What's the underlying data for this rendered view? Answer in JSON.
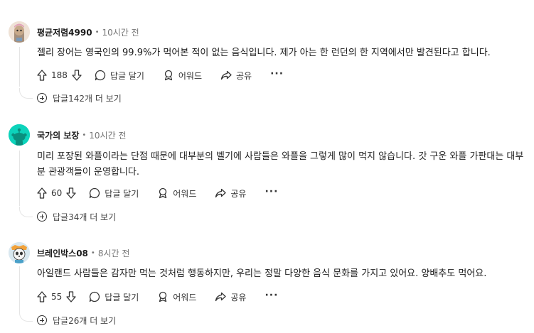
{
  "comments": [
    {
      "author": "평균저렴4990",
      "time": "10시간 전",
      "body": "젤리 장어는 영국인의 99.9%가 먹어본 적이 없는 음식입니다. 제가 아는 한 런던의 한 지역에서만 발견된다고 합니다.",
      "upvotes": "188",
      "more_replies": "답글142개 더 보기",
      "avatar_icon": "cartoon-avatar-icon"
    },
    {
      "author": "국가의 보장",
      "time": "10시간 전",
      "body": "미리 포장된 와플이라는 단점 때문에 대부분의 벨기에 사람들은 와플을 그렇게 많이 먹지 않습니다. 갓 구운 와플 가판대는 대부분 관광객들이 운영합니다.",
      "upvotes": "60",
      "more_replies": "답글34개 더 보기",
      "avatar_icon": "snoo-avatar-icon"
    },
    {
      "author": "브레인박스08",
      "time": "8시간 전",
      "body": "아일랜드 사람들은 감자만 먹는 것처럼 행동하지만, 우리는 정말 다양한 음식 문화를 가지고 있어요. 양배추도 먹어요.",
      "upvotes": "55",
      "more_replies": "답글26개 더 보기",
      "avatar_icon": "panda-avatar-icon"
    }
  ],
  "actions": {
    "reply_label": "답글 달기",
    "award_label": "어워드",
    "share_label": "공유",
    "more_label": "···"
  },
  "separator": "•",
  "colors": {
    "text": "#1c1c1c",
    "muted": "#757575",
    "thread_line": "#e5e5e5",
    "snoo_bg": "#0dd3bb"
  }
}
